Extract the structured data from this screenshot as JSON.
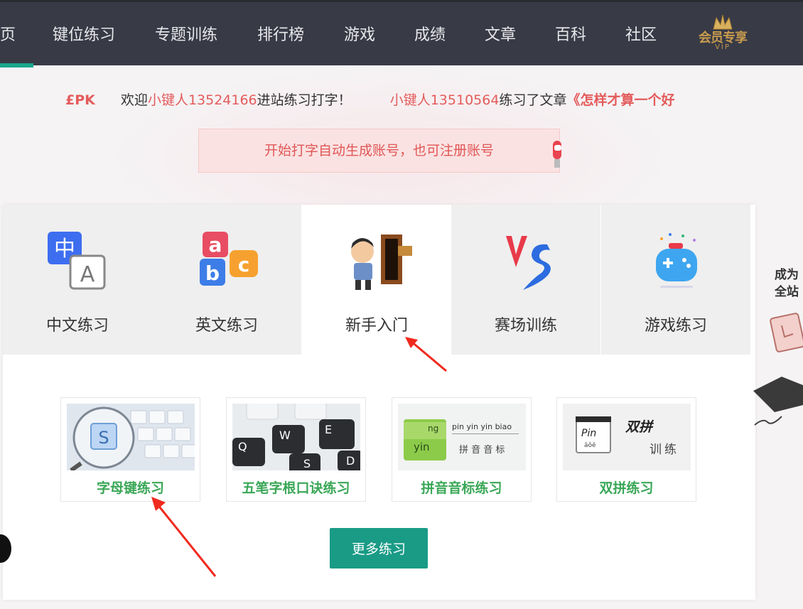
{
  "nav": {
    "items": [
      "页",
      "键位练习",
      "专题训练",
      "排行榜",
      "游戏",
      "成绩",
      "文章",
      "百科",
      "社区"
    ],
    "vip_label": "会员专享",
    "vip_sub": "VIP"
  },
  "ticker": {
    "pk": "£PK",
    "welcome_prefix": "欢迎",
    "welcome_user": "小键人13524166",
    "welcome_suffix": "进站练习打字！",
    "practice_user": "小键人13510564",
    "practice_mid": "练习了文章",
    "practice_article": "《怎样才算一个好"
  },
  "notice": {
    "text": "开始打字自动生成账号，也可注册账号"
  },
  "tabs": [
    {
      "label": "中文练习",
      "icon": "chinese-input-icon"
    },
    {
      "label": "英文练习",
      "icon": "abc-puzzle-icon"
    },
    {
      "label": "新手入门",
      "icon": "newbie-door-icon",
      "active": true
    },
    {
      "label": "赛场训练",
      "icon": "vs-icon"
    },
    {
      "label": "游戏练习",
      "icon": "gamepad-icon"
    }
  ],
  "tiles": [
    {
      "label": "字母键练习",
      "image": "keyboard-magnifier-image"
    },
    {
      "label": "五笔字根口诀练习",
      "image": "wubi-keyboard-image"
    },
    {
      "label": "拼音音标练习",
      "image": "pinyin-notebook-image",
      "img_text_1": "pin yin yin biao",
      "img_text_2": "拼 音 音 标",
      "img_text_3": "yin",
      "img_text_4": "ng"
    },
    {
      "label": "双拼练习",
      "image": "shuangpin-image",
      "img_text_1": "双拼",
      "img_text_2": "训练",
      "img_text_3": "Pin",
      "img_text_4": "āōē"
    }
  ],
  "more_button": "更多练习",
  "side_promo": {
    "line1": "成为",
    "line2": "全站"
  },
  "colors": {
    "nav_bg": "#383a46",
    "accent": "#19a88e",
    "tile_label": "#3aa757",
    "notice_text": "#e05656",
    "ticker_red": "#e45b5b"
  }
}
